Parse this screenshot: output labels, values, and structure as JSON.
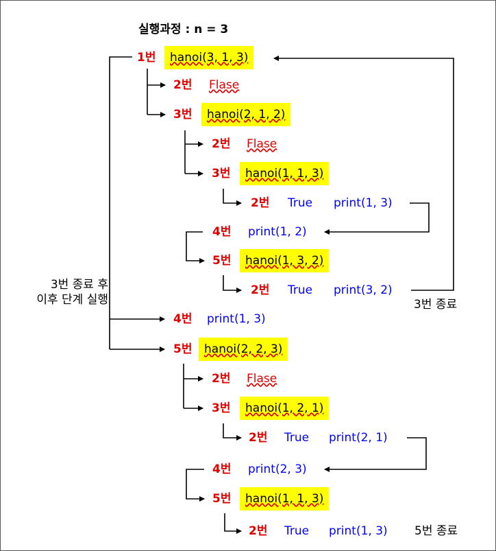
{
  "title": "실행과정 : n = 3",
  "rows": {
    "r1": {
      "step": "1번",
      "call": "hanoi(3, 1, 3)"
    },
    "r2": {
      "step": "2번",
      "text": "Flase"
    },
    "r3": {
      "step": "3번",
      "call": "hanoi(2, 1, 2)"
    },
    "r4": {
      "step": "2번",
      "text": "Flase"
    },
    "r5": {
      "step": "3번",
      "call": "hanoi(1, 1, 3)"
    },
    "r6": {
      "step": "2번",
      "bool": "True",
      "print": "print(1, 3)"
    },
    "r7": {
      "step": "4번",
      "print": "print(1, 2)"
    },
    "r8": {
      "step": "5번",
      "call": "hanoi(1, 3, 2)"
    },
    "r9": {
      "step": "2번",
      "bool": "True",
      "print": "print(3, 2)"
    },
    "r10": {
      "step": "4번",
      "print": "print(1, 3)"
    },
    "r11": {
      "step": "5번",
      "call": "hanoi(2, 2, 3)"
    },
    "r12": {
      "step": "2번",
      "text": "Flase"
    },
    "r13": {
      "step": "3번",
      "call": "hanoi(1, 2, 1)"
    },
    "r14": {
      "step": "2번",
      "bool": "True",
      "print": "print(2, 1)"
    },
    "r15": {
      "step": "4번",
      "print": "print(2, 3)"
    },
    "r16": {
      "step": "5번",
      "call": "hanoi(1, 1, 3)"
    },
    "r17": {
      "step": "2번",
      "bool": "True",
      "print": "print(1, 3)"
    }
  },
  "notes": {
    "left_line1": "3번 종료 후",
    "left_line2": "이후 단계 실행",
    "end3": "3번 종료",
    "end5": "5번 종료"
  }
}
